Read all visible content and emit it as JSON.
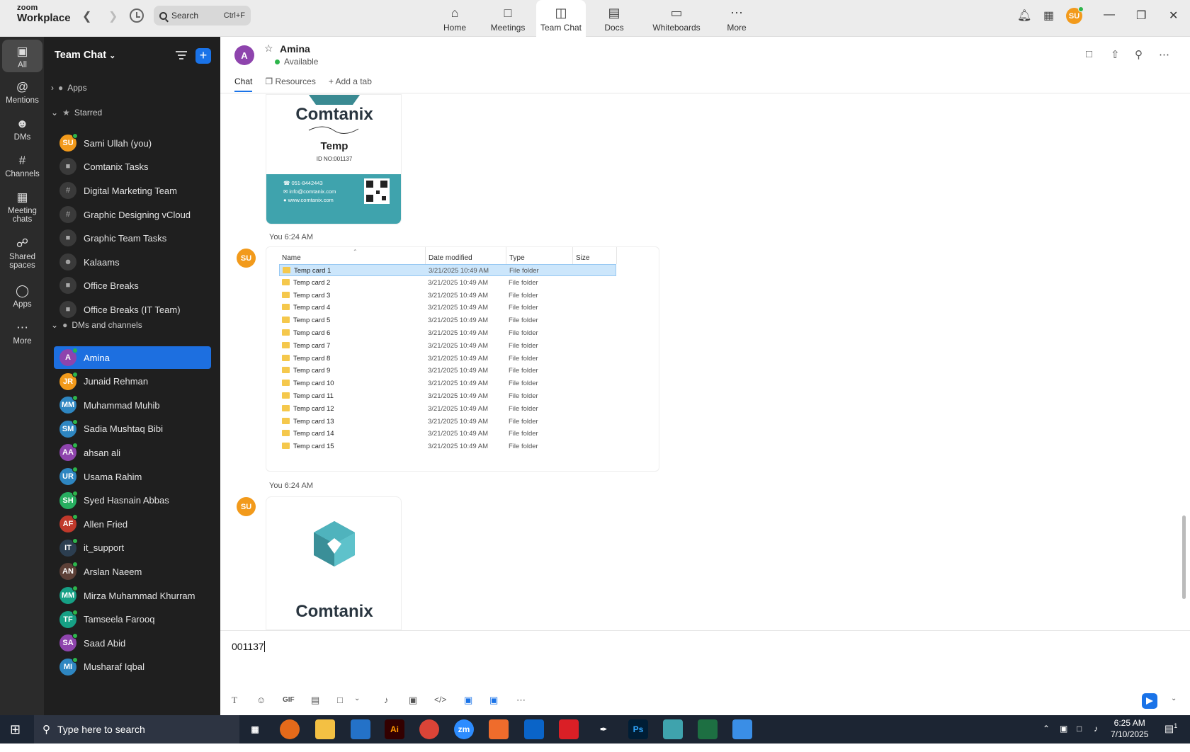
{
  "app": {
    "brand_top": "zoom",
    "brand_bottom": "Workplace"
  },
  "search": {
    "label": "Search",
    "shortcut": "Ctrl+F"
  },
  "nav_tabs": [
    {
      "label": "Home",
      "icon": "home-icon"
    },
    {
      "label": "Meetings",
      "icon": "video-icon"
    },
    {
      "label": "Team Chat",
      "icon": "chat-icon",
      "active": true
    },
    {
      "label": "Docs",
      "icon": "doc-icon"
    },
    {
      "label": "Whiteboards",
      "icon": "whiteboard-icon"
    },
    {
      "label": "More",
      "icon": "more-icon"
    }
  ],
  "user": {
    "initials": "SU",
    "color": "#f29a1b"
  },
  "rail": [
    {
      "label": "All",
      "active": true
    },
    {
      "label": "Mentions"
    },
    {
      "label": "DMs"
    },
    {
      "label": "Channels"
    },
    {
      "label": "Meeting chats"
    },
    {
      "label": "Shared spaces"
    },
    {
      "label": "Apps"
    },
    {
      "label": "More"
    }
  ],
  "sidebar": {
    "title": "Team Chat",
    "apps_label": "Apps",
    "starred_label": "Starred",
    "starred": [
      {
        "label": "Sami Ullah (you)",
        "type": "avatar",
        "initials": "SU",
        "color": "#f29a1b"
      },
      {
        "label": "Comtanix Tasks",
        "type": "lock"
      },
      {
        "label": "Digital Marketing Team",
        "type": "hash"
      },
      {
        "label": "Graphic Designing vCloud",
        "type": "hash"
      },
      {
        "label": "Graphic Team Tasks",
        "type": "lock"
      },
      {
        "label": "Kalaams",
        "type": "group"
      },
      {
        "label": "Office Breaks",
        "type": "lock"
      },
      {
        "label": "Office Breaks (IT Team)",
        "type": "lock"
      }
    ],
    "dms_label": "DMs and channels",
    "dms": [
      {
        "label": "Amina",
        "initials": "A",
        "color": "#8e44ad",
        "active": true
      },
      {
        "label": "Junaid Rehman",
        "initials": "JR",
        "color": "#f29a1b"
      },
      {
        "label": "Muhammad Muhib",
        "initials": "MM",
        "color": "#2e86c1"
      },
      {
        "label": "Sadia Mushtaq Bibi",
        "initials": "SM",
        "color": "#2e86c1"
      },
      {
        "label": "ahsan ali",
        "initials": "AA",
        "color": "#8e44ad"
      },
      {
        "label": "Usama Rahim",
        "initials": "UR",
        "color": "#2e86c1"
      },
      {
        "label": "Syed Hasnain Abbas",
        "initials": "SH",
        "color": "#27ae60"
      },
      {
        "label": "Allen Fried",
        "initials": "AF",
        "color": "#c0392b"
      },
      {
        "label": "it_support",
        "initials": "IT",
        "color": "#2c3e50"
      },
      {
        "label": "Arslan Naeem",
        "initials": "AN",
        "color": "#5d4037"
      },
      {
        "label": "Mirza Muhammad Khurram",
        "initials": "MM",
        "color": "#16a085"
      },
      {
        "label": "Tamseela Farooq",
        "initials": "TF",
        "color": "#16a085"
      },
      {
        "label": "Saad Abid",
        "initials": "SA",
        "color": "#8e44ad"
      },
      {
        "label": "Musharaf Iqbal",
        "initials": "MI",
        "color": "#2e86c1"
      }
    ]
  },
  "chat": {
    "contact": "Amina",
    "contact_initial": "A",
    "status": "Available",
    "tabs": [
      "Chat",
      "Resources",
      "Add a tab"
    ],
    "card1": {
      "brand": "Comtanix",
      "name": "Temp",
      "id": "ID NO:001137",
      "phone": "051-8442443",
      "email": "info@comtanix.com",
      "web": "www.comtanix.com"
    },
    "msg2": {
      "sender": "You",
      "time": "6:24 AM",
      "avatar": "SU"
    },
    "explorer": {
      "headers": [
        "Name",
        "Date modified",
        "Type",
        "Size"
      ],
      "rows": [
        {
          "name": "Temp  card 1",
          "date": "3/21/2025 10:49 AM",
          "type": "File folder"
        },
        {
          "name": "Temp  card 2",
          "date": "3/21/2025 10:49 AM",
          "type": "File folder"
        },
        {
          "name": "Temp  card 3",
          "date": "3/21/2025 10:49 AM",
          "type": "File folder"
        },
        {
          "name": "Temp  card 4",
          "date": "3/21/2025 10:49 AM",
          "type": "File folder"
        },
        {
          "name": "Temp  card 5",
          "date": "3/21/2025 10:49 AM",
          "type": "File folder"
        },
        {
          "name": "Temp  card 6",
          "date": "3/21/2025 10:49 AM",
          "type": "File folder"
        },
        {
          "name": "Temp  card 7",
          "date": "3/21/2025 10:49 AM",
          "type": "File folder"
        },
        {
          "name": "Temp  card 8",
          "date": "3/21/2025 10:49 AM",
          "type": "File folder"
        },
        {
          "name": "Temp  card 9",
          "date": "3/21/2025 10:49 AM",
          "type": "File folder"
        },
        {
          "name": "Temp  card 10",
          "date": "3/21/2025 10:49 AM",
          "type": "File folder"
        },
        {
          "name": "Temp  card 11",
          "date": "3/21/2025 10:49 AM",
          "type": "File folder"
        },
        {
          "name": "Temp  card 12",
          "date": "3/21/2025 10:49 AM",
          "type": "File folder"
        },
        {
          "name": "Temp  card 13",
          "date": "3/21/2025 10:49 AM",
          "type": "File folder"
        },
        {
          "name": "Temp  card 14",
          "date": "3/21/2025 10:49 AM",
          "type": "File folder"
        },
        {
          "name": "Temp  card 15",
          "date": "3/21/2025 10:49 AM",
          "type": "File folder"
        }
      ]
    },
    "msg3": {
      "sender": "You",
      "time": "6:24 AM",
      "avatar": "SU"
    },
    "card2": {
      "brand": "Comtanix"
    },
    "composer_text": "001137",
    "composer_tools": [
      "text-format-icon",
      "emoji-icon",
      "GIF",
      "file-icon",
      "screenshot-icon",
      "mic-icon",
      "video-msg-icon",
      "code-icon",
      "app-icon",
      "app2-icon",
      "more-icon"
    ]
  },
  "taskbar": {
    "search_placeholder": "Type here to search",
    "time": "6:25 AM",
    "date": "7/10/2025",
    "notif_count": "1"
  },
  "colors": {
    "accent": "#1a73e8",
    "teal": "#3fa3ad",
    "available": "#2db54b"
  }
}
